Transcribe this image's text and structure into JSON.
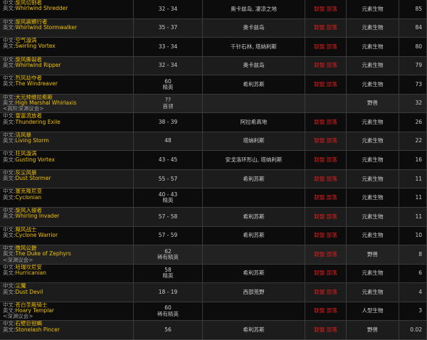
{
  "labels": {
    "cn": "中文:",
    "en": "英文:"
  },
  "rows": [
    {
      "cn": "旋风切割者",
      "en": "Whirlwind Shredder",
      "extra": "",
      "level": "32 - 34",
      "level2": "",
      "zone": "奥卡兹岛, 凄凉之地",
      "faction": "联盟 部落",
      "type": "元素生物",
      "pct": "85",
      "alt": false
    },
    {
      "cn": "旋风震颤行者",
      "en": "Whirlwind Stormwalker",
      "extra": "",
      "level": "35 - 37",
      "level2": "",
      "zone": "奥卡兹岛",
      "faction": "联盟 部落",
      "type": "元素生物",
      "pct": "84",
      "alt": true
    },
    {
      "cn": "空气漩涡",
      "en": "Swirling Vortex",
      "extra": "",
      "level": "33 - 34",
      "level2": "",
      "zone": "千针石林, 塔纳利斯",
      "faction": "联盟 部落",
      "type": "元素生物",
      "pct": "80",
      "alt": false
    },
    {
      "cn": "旋风撕裂者",
      "en": "Whirlwind Ripper",
      "extra": "",
      "level": "32 - 34",
      "level2": "",
      "zone": "奥卡兹岛",
      "faction": "联盟 部落",
      "type": "元素生物",
      "pct": "79",
      "alt": true
    },
    {
      "cn": "烈风劫夺者",
      "en": "The Windreaver",
      "extra": "",
      "level": "60",
      "level2": "精英",
      "zone": "希利苏斯",
      "faction": "联盟 部落",
      "type": "元素生物",
      "pct": "73",
      "alt": false
    },
    {
      "cn": "大元帅维拉希斯",
      "en": "High Marshal Whirlaxis",
      "extra": "<高阶深渊议会>",
      "level": "??",
      "level2": "首领",
      "zone": "",
      "faction": "",
      "type": "野兽",
      "pct": "32",
      "alt": true,
      "tall": true
    },
    {
      "cn": "雷霆流放者",
      "en": "Thundering Exile",
      "extra": "",
      "level": "38 - 39",
      "level2": "",
      "zone": "阿拉希高地",
      "faction": "联盟 部落",
      "type": "元素生物",
      "pct": "26",
      "alt": false
    },
    {
      "cn": "活风暴",
      "en": "Living Storm",
      "extra": "",
      "level": "48",
      "level2": "",
      "zone": "塔纳利斯",
      "faction": "联盟 部落",
      "type": "元素生物",
      "pct": "22",
      "alt": true
    },
    {
      "cn": "狂风漩涡",
      "en": "Gusting Vortex",
      "extra": "",
      "level": "43 - 45",
      "level2": "",
      "zone": "安戈洛环形山, 塔纳利斯",
      "faction": "联盟 部落",
      "type": "元素生物",
      "pct": "16",
      "alt": false
    },
    {
      "cn": "灰尘风暴",
      "en": "Dust Stormer",
      "extra": "",
      "level": "55 - 57",
      "level2": "",
      "zone": "希利苏斯",
      "faction": "联盟 部落",
      "type": "元素生物",
      "pct": "11",
      "alt": true
    },
    {
      "cn": "塞克隆尼亚",
      "en": "Cyclonian",
      "extra": "",
      "level": "40 - 43",
      "level2": "精英",
      "zone": "",
      "faction": "联盟 部落",
      "type": "元素生物",
      "pct": "11",
      "alt": false
    },
    {
      "cn": "旋风入侵者",
      "en": "Whirling Invader",
      "extra": "",
      "level": "57 - 58",
      "level2": "",
      "zone": "希利苏斯",
      "faction": "联盟 部落",
      "type": "元素生物",
      "pct": "11",
      "alt": true
    },
    {
      "cn": "飓风战士",
      "en": "Cyclone Warrior",
      "extra": "",
      "level": "57 - 59",
      "level2": "",
      "zone": "希利苏斯",
      "faction": "联盟 部落",
      "type": "元素生物",
      "pct": "10",
      "alt": false
    },
    {
      "cn": "微风公爵",
      "en": "The Duke of Zephyrs",
      "extra": "<深渊议会>",
      "level": "62",
      "level2": "稀有精英",
      "zone": "",
      "faction": "联盟 部落",
      "type": "野兽",
      "pct": "8",
      "alt": true,
      "tall": true
    },
    {
      "cn": "哈瑞坎尼安",
      "en": "Hurricanian",
      "extra": "",
      "level": "58",
      "level2": "精英",
      "zone": "希利苏斯",
      "faction": "联盟 部落",
      "type": "元素生物",
      "pct": "6",
      "alt": false
    },
    {
      "cn": "尘魔",
      "en": "Dust Devil",
      "extra": "",
      "level": "18 - 19",
      "level2": "",
      "zone": "西部荒野",
      "faction": "联盟 部落",
      "type": "元素生物",
      "pct": "4",
      "alt": true
    },
    {
      "cn": "苍白圣殿骑士",
      "en": "Hoary Templar",
      "extra": "<深渊议会>",
      "level": "60",
      "level2": "稀有精英",
      "zone": "",
      "faction": "联盟 部落",
      "type": "人型生物",
      "pct": "3",
      "alt": false,
      "tall": true
    },
    {
      "cn": "石壁巨钳蝎",
      "en": "Stonelash Pincer",
      "extra": "",
      "level": "56",
      "level2": "",
      "zone": "希利苏斯",
      "faction": "联盟 部落",
      "type": "野兽",
      "pct": "0.02",
      "alt": true
    }
  ]
}
